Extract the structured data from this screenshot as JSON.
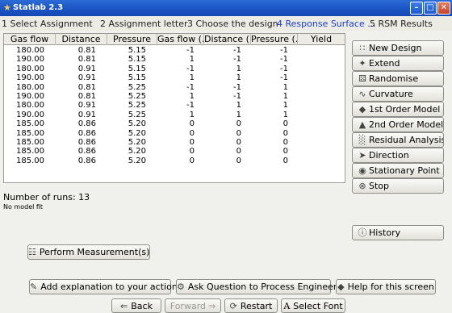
{
  "window": {
    "title": "Statlab 2.3"
  },
  "steps": [
    {
      "label": "1 Select Assignment",
      "active": false
    },
    {
      "label": "2 Assignment letter",
      "active": false
    },
    {
      "label": "3 Choose the design",
      "active": false
    },
    {
      "label": "4 Response Surface ...",
      "active": true
    },
    {
      "label": "5 RSM Results",
      "active": false
    }
  ],
  "table": {
    "columns": [
      "Gas flow",
      "Distance",
      "Pressure",
      "Gas flow (...",
      "Distance (...",
      "Pressure (...",
      "Yield"
    ],
    "rows": [
      [
        "180.00",
        "0.81",
        "5.15",
        "-1",
        "-1",
        "-1",
        ""
      ],
      [
        "190.00",
        "0.81",
        "5.15",
        "1",
        "-1",
        "-1",
        ""
      ],
      [
        "180.00",
        "0.91",
        "5.15",
        "-1",
        "1",
        "-1",
        ""
      ],
      [
        "190.00",
        "0.91",
        "5.15",
        "1",
        "1",
        "-1",
        ""
      ],
      [
        "180.00",
        "0.81",
        "5.25",
        "-1",
        "-1",
        "1",
        ""
      ],
      [
        "190.00",
        "0.81",
        "5.25",
        "1",
        "-1",
        "1",
        ""
      ],
      [
        "180.00",
        "0.91",
        "5.25",
        "-1",
        "1",
        "1",
        ""
      ],
      [
        "190.00",
        "0.91",
        "5.25",
        "1",
        "1",
        "1",
        ""
      ],
      [
        "185.00",
        "0.86",
        "5.20",
        "0",
        "0",
        "0",
        ""
      ],
      [
        "185.00",
        "0.86",
        "5.20",
        "0",
        "0",
        "0",
        ""
      ],
      [
        "185.00",
        "0.86",
        "5.20",
        "0",
        "0",
        "0",
        ""
      ],
      [
        "185.00",
        "0.86",
        "5.20",
        "0",
        "0",
        "0",
        ""
      ],
      [
        "185.00",
        "0.86",
        "5.20",
        "0",
        "0",
        "0",
        ""
      ]
    ]
  },
  "side_buttons": [
    {
      "label": "New Design",
      "icon": "scatter-icon",
      "glyph": "∷"
    },
    {
      "label": "Extend",
      "icon": "extend-icon",
      "glyph": "✦"
    },
    {
      "label": "Randomise",
      "icon": "randomise-icon",
      "glyph": "⚄"
    },
    {
      "label": "Curvature",
      "icon": "curvature-icon",
      "glyph": "∿"
    },
    {
      "label": "1st Order Model",
      "icon": "plane-icon",
      "glyph": "◆"
    },
    {
      "label": "2nd Order Model",
      "icon": "surface-icon",
      "glyph": "▲"
    },
    {
      "label": "Residual Analysis",
      "icon": "residual-icon",
      "glyph": "░"
    },
    {
      "label": "Direction",
      "icon": "direction-icon",
      "glyph": "➤"
    },
    {
      "label": "Stationary Point",
      "icon": "stationary-icon",
      "glyph": "◉"
    },
    {
      "label": "Stop",
      "icon": "stop-icon",
      "glyph": "⊗"
    }
  ],
  "history_label": "History",
  "runs_text": "Number of runs: 13",
  "model_text": "No model fit",
  "perform_label": "Perform Measurement(s)",
  "explain_label": "Add explanation to your action",
  "ask_label": "Ask Question to Process Engineer",
  "help_label": "Help for this screen",
  "nav": {
    "back": "Back",
    "forward": "Forward",
    "restart": "Restart",
    "font": "Select Font"
  },
  "colors": {
    "titlebar": "#1d56c6",
    "active_step": "#1a3fd0"
  }
}
